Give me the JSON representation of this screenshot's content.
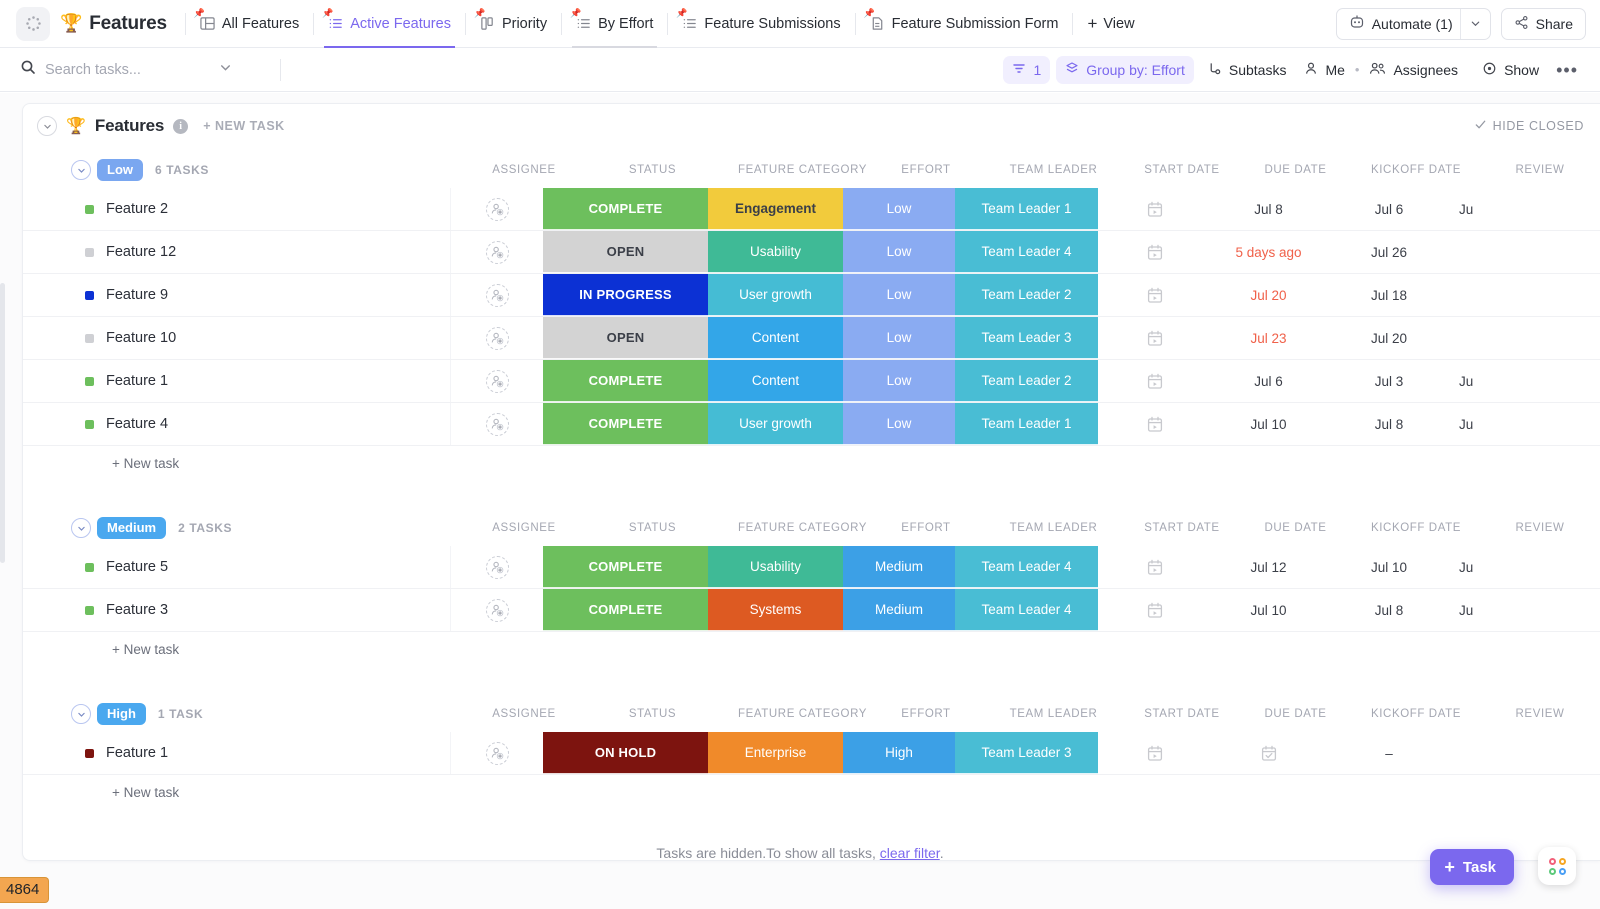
{
  "topbar": {
    "app_icon": "dots-circle-icon",
    "view_title": "Features",
    "trophy": "🏆",
    "tabs": [
      {
        "label": "All Features",
        "icon": "table-icon",
        "active": false
      },
      {
        "label": "Active Features",
        "icon": "list-icon",
        "active": true
      },
      {
        "label": "Priority",
        "icon": "board-icon",
        "active": false
      },
      {
        "label": "By Effort",
        "icon": "list-icon",
        "active": false
      },
      {
        "label": "Feature Submissions",
        "icon": "list-icon",
        "active": false
      },
      {
        "label": "Feature Submission Form",
        "icon": "form-icon",
        "active": false
      }
    ],
    "add_view": "View",
    "automate": "Automate (1)",
    "share": "Share"
  },
  "filterbar": {
    "search_placeholder": "Search tasks...",
    "filter_count": "1",
    "group_by": "Group by: Effort",
    "subtasks": "Subtasks",
    "me": "Me",
    "assignees": "Assignees",
    "show": "Show",
    "more": "•••"
  },
  "list": {
    "title": "Features",
    "trophy": "🏆",
    "info": "i",
    "new_task": "+ NEW TASK",
    "hide_closed": "HIDE CLOSED",
    "new_task_row": "+ New task"
  },
  "columns": [
    "ASSIGNEE",
    "STATUS",
    "FEATURE CATEGORY",
    "EFFORT",
    "TEAM LEADER",
    "START DATE",
    "DUE DATE",
    "KICKOFF DATE",
    "REVIEW"
  ],
  "colors": {
    "accent": "#7b68ee",
    "complete": "#6dbf5d",
    "open": "#d3d3d3",
    "in_progress": "#0c31d4",
    "on_hold": "#7d140f",
    "engagement": "#f2cb3c",
    "usability": "#3fba96",
    "user_growth": "#45bcd4",
    "content": "#33a6e8",
    "systems": "#dd5a22",
    "enterprise": "#f08a2a",
    "effort_low": "#8aabf2",
    "effort_medium": "#3ca0e6",
    "effort_high": "#3ca0e6",
    "team_leader": "#49bdd4",
    "overdue": "#f0614a",
    "pill_low": "#7aa7f0",
    "pill_medium": "#4aa8ef",
    "pill_high": "#4aa8ef"
  },
  "groups": [
    {
      "name": "Low",
      "pill_color": "#7aa7f0",
      "count_label": "6 TASKS",
      "rows": [
        {
          "dot": "#6dbf5d",
          "name": "Feature 2",
          "status": "COMPLETE",
          "status_bg": "#6dbf5d",
          "status_dark": false,
          "category": "Engagement",
          "category_bg": "#f2cb3c",
          "category_dark": true,
          "effort": "Low",
          "effort_bg": "#8aabf2",
          "leader": "Team Leader 1",
          "leader_bg": "#49bdd4",
          "start_icon": "calendar-play-icon",
          "due": "Jul 8",
          "due_overdue": false,
          "kickoff": "Jul 6",
          "kickoff_overdue": false,
          "review": "Ju"
        },
        {
          "dot": "#cfd0d4",
          "name": "Feature 12",
          "status": "OPEN",
          "status_bg": "#d3d3d3",
          "status_dark": true,
          "category": "Usability",
          "category_bg": "#3fba96",
          "category_dark": false,
          "effort": "Low",
          "effort_bg": "#8aabf2",
          "leader": "Team Leader 4",
          "leader_bg": "#49bdd4",
          "start_icon": "calendar-play-icon",
          "due": "5 days ago",
          "due_overdue": true,
          "kickoff": "Jul 26",
          "kickoff_overdue": false,
          "review": ""
        },
        {
          "dot": "#0c31d4",
          "name": "Feature 9",
          "status": "IN PROGRESS",
          "status_bg": "#0c31d4",
          "status_dark": false,
          "category": "User growth",
          "category_bg": "#45bcd4",
          "category_dark": false,
          "effort": "Low",
          "effort_bg": "#8aabf2",
          "leader": "Team Leader 2",
          "leader_bg": "#49bdd4",
          "start_icon": "calendar-play-icon",
          "due": "Jul 20",
          "due_overdue": true,
          "kickoff": "Jul 18",
          "kickoff_overdue": false,
          "review": ""
        },
        {
          "dot": "#cfd0d4",
          "name": "Feature 10",
          "status": "OPEN",
          "status_bg": "#d3d3d3",
          "status_dark": true,
          "category": "Content",
          "category_bg": "#33a6e8",
          "category_dark": false,
          "effort": "Low",
          "effort_bg": "#8aabf2",
          "leader": "Team Leader 3",
          "leader_bg": "#49bdd4",
          "start_icon": "calendar-play-icon",
          "due": "Jul 23",
          "due_overdue": true,
          "kickoff": "Jul 20",
          "kickoff_overdue": false,
          "review": ""
        },
        {
          "dot": "#6dbf5d",
          "name": "Feature 1",
          "status": "COMPLETE",
          "status_bg": "#6dbf5d",
          "status_dark": false,
          "category": "Content",
          "category_bg": "#33a6e8",
          "category_dark": false,
          "effort": "Low",
          "effort_bg": "#8aabf2",
          "leader": "Team Leader 2",
          "leader_bg": "#49bdd4",
          "start_icon": "calendar-play-icon",
          "due": "Jul 6",
          "due_overdue": false,
          "kickoff": "Jul 3",
          "kickoff_overdue": false,
          "review": "Ju"
        },
        {
          "dot": "#6dbf5d",
          "name": "Feature 4",
          "status": "COMPLETE",
          "status_bg": "#6dbf5d",
          "status_dark": false,
          "category": "User growth",
          "category_bg": "#45bcd4",
          "category_dark": false,
          "effort": "Low",
          "effort_bg": "#8aabf2",
          "leader": "Team Leader 1",
          "leader_bg": "#49bdd4",
          "start_icon": "calendar-play-icon",
          "due": "Jul 10",
          "due_overdue": false,
          "kickoff": "Jul 8",
          "kickoff_overdue": false,
          "review": "Ju"
        }
      ]
    },
    {
      "name": "Medium",
      "pill_color": "#4aa8ef",
      "count_label": "2 TASKS",
      "rows": [
        {
          "dot": "#6dbf5d",
          "name": "Feature 5",
          "status": "COMPLETE",
          "status_bg": "#6dbf5d",
          "status_dark": false,
          "category": "Usability",
          "category_bg": "#3fba96",
          "category_dark": false,
          "effort": "Medium",
          "effort_bg": "#3ca0e6",
          "leader": "Team Leader 4",
          "leader_bg": "#49bdd4",
          "start_icon": "calendar-play-icon",
          "due": "Jul 12",
          "due_overdue": false,
          "kickoff": "Jul 10",
          "kickoff_overdue": false,
          "review": "Ju"
        },
        {
          "dot": "#6dbf5d",
          "name": "Feature 3",
          "status": "COMPLETE",
          "status_bg": "#6dbf5d",
          "status_dark": false,
          "category": "Systems",
          "category_bg": "#dd5a22",
          "category_dark": false,
          "effort": "Medium",
          "effort_bg": "#3ca0e6",
          "leader": "Team Leader 4",
          "leader_bg": "#49bdd4",
          "start_icon": "calendar-play-icon",
          "due": "Jul 10",
          "due_overdue": false,
          "kickoff": "Jul 8",
          "kickoff_overdue": false,
          "review": "Ju"
        }
      ]
    },
    {
      "name": "High",
      "pill_color": "#4aa8ef",
      "count_label": "1 TASK",
      "rows": [
        {
          "dot": "#7d140f",
          "name": "Feature 1",
          "status": "ON HOLD",
          "status_bg": "#7d140f",
          "status_dark": false,
          "category": "Enterprise",
          "category_bg": "#f08a2a",
          "category_dark": false,
          "effort": "High",
          "effort_bg": "#3ca0e6",
          "leader": "Team Leader 3",
          "leader_bg": "#49bdd4",
          "start_icon": "calendar-play-icon",
          "due": "",
          "due_icon": "calendar-check-icon",
          "due_overdue": false,
          "kickoff": "–",
          "kickoff_overdue": false,
          "review": ""
        }
      ]
    }
  ],
  "footer": {
    "note_prefix": "Tasks are hidden.To show all tasks,",
    "note_link": "clear filter",
    "note_suffix": ".",
    "fab_task": "Task",
    "corner_badge": "4864"
  }
}
